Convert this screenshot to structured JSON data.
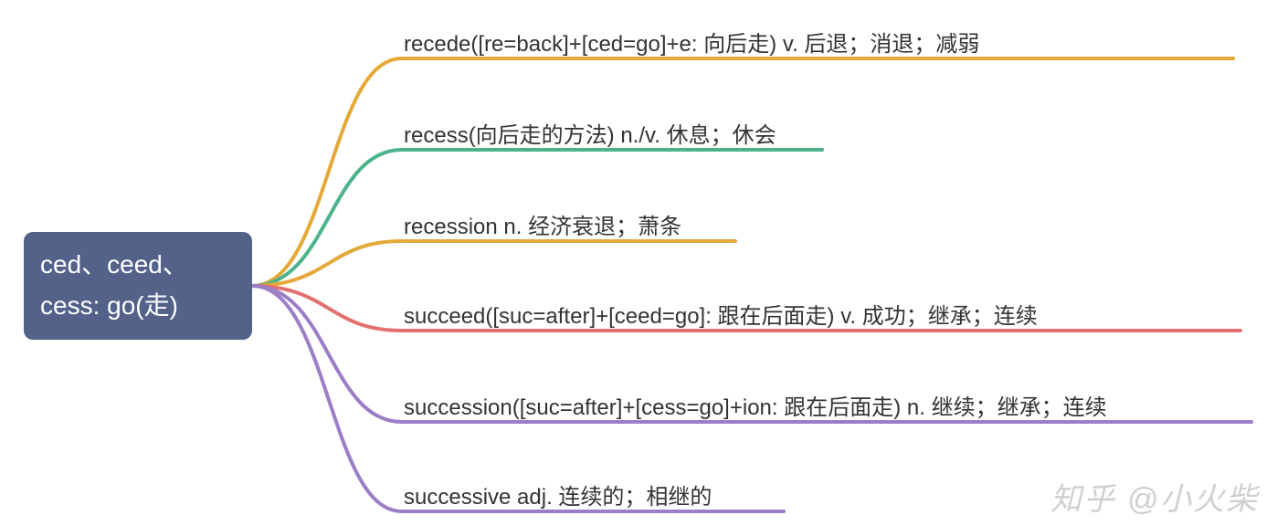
{
  "root": {
    "line1": "ced、ceed、",
    "line2": "cess: go(走)"
  },
  "branches": [
    {
      "label": "recede([re=back]+[ced=go]+e: 向后走) v. 后退；消退；减弱",
      "color": "#e4a938"
    },
    {
      "label": "recess(向后走的方法) n./v. 休息；休会",
      "color": "#4bb38a"
    },
    {
      "label": "recession n. 经济衰退；萧条",
      "color": "#e4a938"
    },
    {
      "label": "succeed([suc=after]+[ceed=go]: 跟在后面走) v. 成功；继承；连续",
      "color": "#e36f6f"
    },
    {
      "label": "succession([suc=after]+[cess=go]+ion: 跟在后面走) n. 继续；继承；连续",
      "color": "#9c7ec7"
    },
    {
      "label": "successive adj. 连续的；相继的",
      "color": "#9c7ec7"
    }
  ],
  "watermark": "知乎 @小火柴",
  "chart_data": {
    "type": "mindmap",
    "root": "ced、ceed、cess: go(走)",
    "children": [
      "recede([re=back]+[ced=go]+e: 向后走) v. 后退；消退；减弱",
      "recess(向后走的方法) n./v. 休息；休会",
      "recession n. 经济衰退；萧条",
      "succeed([suc=after]+[ceed=go]: 跟在后面走) v. 成功；继承；连续",
      "succession([suc=after]+[cess=go]+ion: 跟在后面走) n. 继续；继承；连续",
      "successive adj. 连续的；相继的"
    ]
  }
}
